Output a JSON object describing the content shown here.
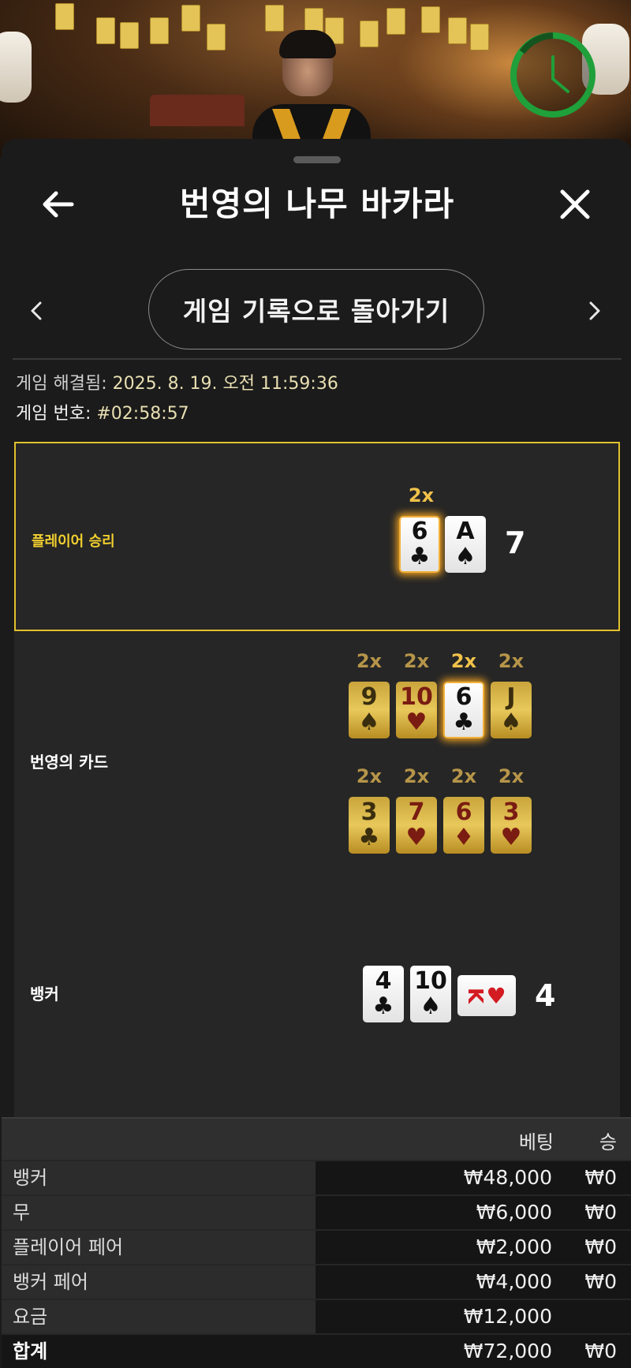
{
  "header": {
    "title": "번영의 나무 바카라",
    "back_to_history": "게임 기록으로 돌아가기"
  },
  "meta": {
    "resolved_label": "게임 해결됨:",
    "resolved_value": " 2025. 8. 19. 오전 11:59:36",
    "number_label": "게임 번호:",
    "number_value": " #02:58:57"
  },
  "player": {
    "label": "플레이어 승리",
    "multiplier": "2x",
    "cards": [
      {
        "rank": "6",
        "suit": "♣"
      },
      {
        "rank": "A",
        "suit": "♠"
      }
    ],
    "score": "7"
  },
  "royal": {
    "label": "번영의 카드",
    "row1": [
      {
        "mult": "2x",
        "rank": "9",
        "suit": "♠",
        "color": "black"
      },
      {
        "mult": "2x",
        "rank": "10",
        "suit": "♥",
        "color": "red"
      },
      {
        "mult": "2x",
        "rank": "6",
        "suit": "♣",
        "color": "black"
      },
      {
        "mult": "2x",
        "rank": "J",
        "suit": "♠",
        "color": "black"
      }
    ],
    "row2": [
      {
        "mult": "2x",
        "rank": "3",
        "suit": "♣",
        "color": "black"
      },
      {
        "mult": "2x",
        "rank": "7",
        "suit": "♥",
        "color": "red"
      },
      {
        "mult": "2x",
        "rank": "6",
        "suit": "♦",
        "color": "red"
      },
      {
        "mult": "2x",
        "rank": "3",
        "suit": "♥",
        "color": "red"
      }
    ]
  },
  "banker": {
    "label": "뱅커",
    "cards": [
      {
        "rank": "4",
        "suit": "♣"
      },
      {
        "rank": "10",
        "suit": "♠"
      },
      {
        "rank": "K",
        "suit": "♥"
      }
    ],
    "score": "4"
  },
  "bets": {
    "col_bet": "베팅",
    "col_win": "승",
    "rows": [
      {
        "name": "뱅커",
        "bet": "₩48,000",
        "win": "₩0"
      },
      {
        "name": "무",
        "bet": "₩6,000",
        "win": "₩0"
      },
      {
        "name": "플레이어 페어",
        "bet": "₩2,000",
        "win": "₩0"
      },
      {
        "name": "뱅커 페어",
        "bet": "₩4,000",
        "win": "₩0"
      },
      {
        "name": "요금",
        "bet": "₩12,000",
        "win": ""
      }
    ],
    "total": {
      "name": "합계",
      "bet": "₩72,000",
      "win": "₩0"
    }
  },
  "colors": {
    "accent_gold": "#e2c12d",
    "timer_green": "#1fa03a"
  }
}
